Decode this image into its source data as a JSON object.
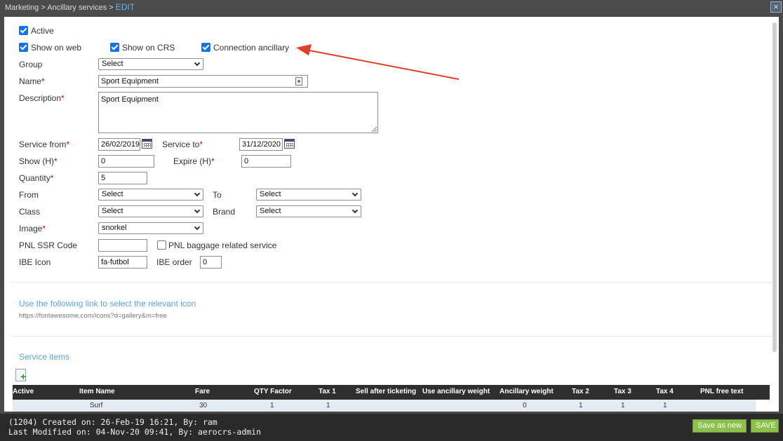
{
  "breadcrumb": {
    "prefix": "Marketing > Ancillary services > ",
    "current": "EDIT"
  },
  "form": {
    "active": {
      "label": "Active",
      "checked": true
    },
    "show_on_web": {
      "label": "Show on web",
      "checked": true
    },
    "show_on_crs": {
      "label": "Show on CRS",
      "checked": true
    },
    "connection_ancillary": {
      "label": "Connection ancillary",
      "checked": true
    },
    "group": {
      "label": "Group",
      "value": "Select"
    },
    "name": {
      "label": "Name",
      "value": "Sport Equipment"
    },
    "description": {
      "label": "Description",
      "value": "Sport Equipment"
    },
    "service_from": {
      "label": "Service from",
      "value": "26/02/2019"
    },
    "service_to": {
      "label": "Service to",
      "value": "31/12/2020"
    },
    "show_h": {
      "label": "Show (H)",
      "value": "0"
    },
    "expire_h": {
      "label": "Expire (H)",
      "value": "0"
    },
    "quantity": {
      "label": "Quantity",
      "value": "5"
    },
    "from": {
      "label": "From",
      "value": "Select"
    },
    "to": {
      "label": "To",
      "value": "Select"
    },
    "class": {
      "label": "Class",
      "value": "Select"
    },
    "brand": {
      "label": "Brand",
      "value": "Select"
    },
    "image": {
      "label": "Image",
      "value": "snorkel"
    },
    "pnl_ssr_code": {
      "label": "PNL SSR Code",
      "value": ""
    },
    "pnl_baggage": {
      "label": "PNL baggage related service",
      "checked": false
    },
    "ibe_icon": {
      "label": "IBE Icon",
      "value": "fa-futbol"
    },
    "ibe_order": {
      "label": "IBE order",
      "value": "0"
    },
    "required_mark": "*"
  },
  "icon_link": {
    "text": "Use the following link to select the relevant icon",
    "url": "https://fontawesome.com/icons?d=gallery&m=free"
  },
  "service_items": {
    "title": "Service items",
    "columns": [
      "Active",
      "Item Name",
      "Fare",
      "QTY Factor",
      "Tax 1",
      "Sell after ticketing",
      "Use ancillary weight",
      "Ancillary weight",
      "Tax 2",
      "Tax 3",
      "Tax 4",
      "PNL free text"
    ],
    "rows": [
      {
        "item_name": "Surf",
        "fare": "30",
        "qty_factor": "1",
        "tax1": "1",
        "ancillary_weight": "0",
        "tax2": "1",
        "tax3": "1",
        "tax4": "1"
      }
    ]
  },
  "footer": {
    "created": "(1204) Created on: 26-Feb-19 16:21, By: ram",
    "modified": "Last Modified on: 04-Nov-20 09:41, By: aerocrs-admin",
    "save_as_new": "Save as new",
    "save": "SAVE"
  },
  "colors": {
    "accent": "#1473e6",
    "link": "#5aa6d8",
    "button": "#8bc14a",
    "annotation_arrow": "#e0402a"
  }
}
